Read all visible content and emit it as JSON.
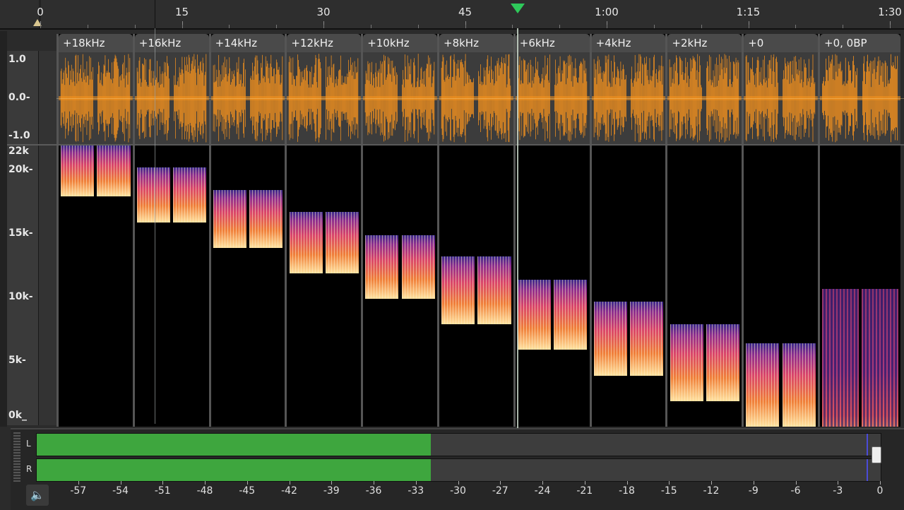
{
  "timeline": {
    "labels": [
      {
        "text": "0",
        "pos": 0
      },
      {
        "text": "15",
        "pos": 15
      },
      {
        "text": "30",
        "pos": 30
      },
      {
        "text": "45",
        "pos": 45
      },
      {
        "text": "1:00",
        "pos": 60
      },
      {
        "text": "1:15",
        "pos": 75
      },
      {
        "text": "1:30",
        "pos": 90
      }
    ],
    "playhead_seconds": 50.5
  },
  "amplitude_axis": {
    "labels": [
      "1.0",
      "0.0-",
      "-1.0"
    ]
  },
  "frequency_axis": {
    "labels": [
      "22k",
      "20k-",
      "15k-",
      "10k-",
      "5k-",
      "0k_"
    ]
  },
  "clips": [
    {
      "name": "+18kHz",
      "low": 18,
      "high": 22
    },
    {
      "name": "+16kHz",
      "low": 16,
      "high": 20.3
    },
    {
      "name": "+14kHz",
      "low": 14,
      "high": 18.5
    },
    {
      "name": "+12kHz",
      "low": 12,
      "high": 16.8
    },
    {
      "name": "+10kHz",
      "low": 10,
      "high": 15
    },
    {
      "name": "+8kHz",
      "low": 8,
      "high": 13.3
    },
    {
      "name": "+6kHz",
      "low": 6,
      "high": 11.5
    },
    {
      "name": "+4kHz",
      "low": 4,
      "high": 9.8
    },
    {
      "name": "+2kHz",
      "low": 2,
      "high": 8
    },
    {
      "name": "+0",
      "low": 0,
      "high": 6.5
    },
    {
      "name": "+0, 0BP",
      "low": 0,
      "high": 10.8
    }
  ],
  "meter": {
    "channels": [
      {
        "label": "L",
        "level_db": -32,
        "peak_db": -1
      },
      {
        "label": "R",
        "level_db": -32,
        "peak_db": -1
      }
    ],
    "scale": [
      "-57",
      "-54",
      "-51",
      "-48",
      "-45",
      "-42",
      "-39",
      "-36",
      "-33",
      "-30",
      "-27",
      "-24",
      "-21",
      "-18",
      "-15",
      "-12",
      "-9",
      "-6",
      "-3",
      "0"
    ]
  },
  "colors": {
    "waveform": "#f7931e",
    "meter_fill": "#3ea63e",
    "playhead_marker": "#2ec95a"
  },
  "icons": {
    "speaker": "speaker-icon"
  }
}
